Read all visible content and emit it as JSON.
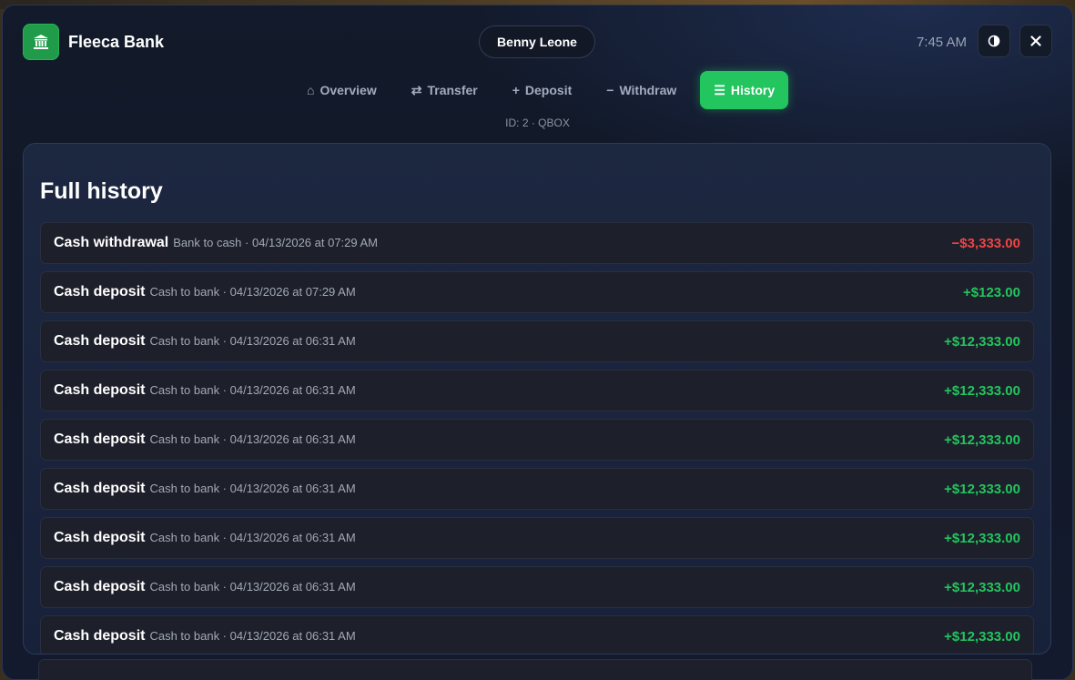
{
  "header": {
    "brand": "Fleeca Bank",
    "user_name": "Benny Leone",
    "time": "7:45 AM",
    "account_id": "ID: 2 · QBOX"
  },
  "nav": {
    "overview": {
      "glyph": "⌂",
      "label": "Overview"
    },
    "transfer": {
      "glyph": "⇄",
      "label": "Transfer"
    },
    "deposit": {
      "glyph": "+",
      "label": "Deposit"
    },
    "withdraw": {
      "glyph": "−",
      "label": "Withdraw"
    },
    "history": {
      "glyph": "☰",
      "label": "History"
    }
  },
  "main": {
    "title": "Full history",
    "transactions": [
      {
        "title": "Cash withdrawal",
        "detail": "Bank to cash · 04/13/2026 at 07:29 AM",
        "amount": "−$3,333.00"
      },
      {
        "title": "Cash deposit",
        "detail": "Cash to bank · 04/13/2026 at 07:29 AM",
        "amount": "+$123.00"
      },
      {
        "title": "Cash deposit",
        "detail": "Cash to bank · 04/13/2026 at 06:31 AM",
        "amount": "+$12,333.00"
      },
      {
        "title": "Cash deposit",
        "detail": "Cash to bank · 04/13/2026 at 06:31 AM",
        "amount": "+$12,333.00"
      },
      {
        "title": "Cash deposit",
        "detail": "Cash to bank · 04/13/2026 at 06:31 AM",
        "amount": "+$12,333.00"
      },
      {
        "title": "Cash deposit",
        "detail": "Cash to bank · 04/13/2026 at 06:31 AM",
        "amount": "+$12,333.00"
      },
      {
        "title": "Cash deposit",
        "detail": "Cash to bank · 04/13/2026 at 06:31 AM",
        "amount": "+$12,333.00"
      },
      {
        "title": "Cash deposit",
        "detail": "Cash to bank · 04/13/2026 at 06:31 AM",
        "amount": "+$12,333.00"
      },
      {
        "title": "Cash deposit",
        "detail": "Cash to bank · 04/13/2026 at 06:31 AM",
        "amount": "+$12,333.00"
      }
    ]
  },
  "colors": {
    "accent": "#22c55e",
    "negative": "#ef4444",
    "panel": "#1c2740",
    "window": "#111827"
  },
  "icons": {
    "logo": "bank-icon",
    "theme": "contrast-icon",
    "close": "close-icon"
  }
}
